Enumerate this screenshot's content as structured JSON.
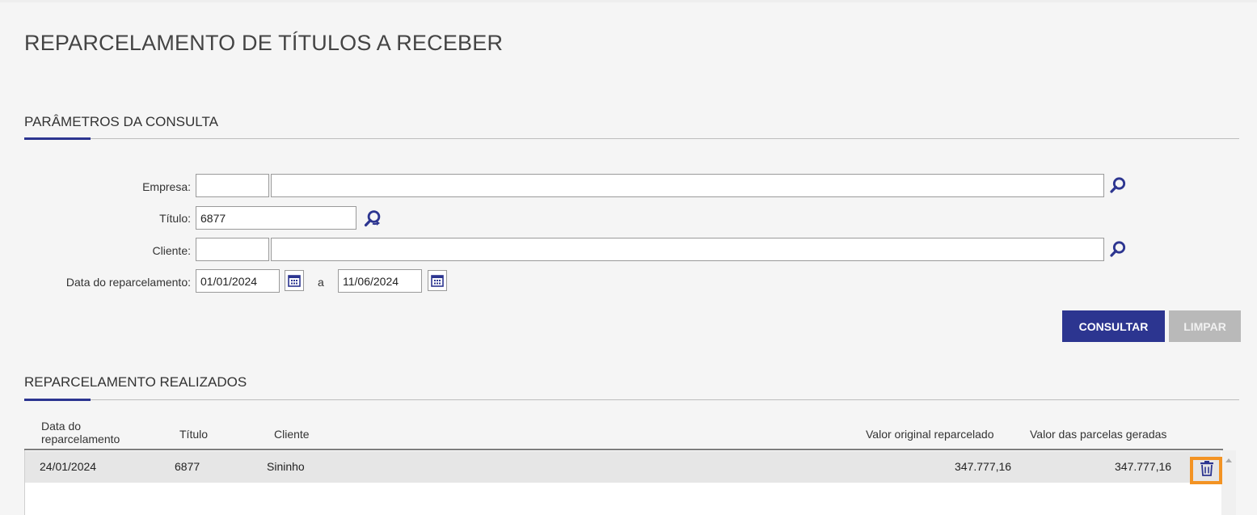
{
  "page": {
    "title": "REPARCELAMENTO DE TÍTULOS A RECEBER"
  },
  "query_section": {
    "title": "PARÂMETROS DA CONSULTA",
    "fields": {
      "empresa_label": "Empresa:",
      "empresa_code": "",
      "empresa_name": "",
      "titulo_label": "Título:",
      "titulo_value": "6877",
      "cliente_label": "Cliente:",
      "cliente_code": "",
      "cliente_name": "",
      "data_label": "Data do reparcelamento:",
      "data_from": "01/01/2024",
      "data_sep": "a",
      "data_to": "11/06/2024"
    },
    "buttons": {
      "consultar": "CONSULTAR",
      "limpar": "LIMPAR"
    }
  },
  "results_section": {
    "title": "REPARCELAMENTO REALIZADOS",
    "columns": {
      "data_line1": "Data do",
      "data_line2": "reparcelamento",
      "titulo": "Título",
      "cliente": "Cliente",
      "valor_original": "Valor original reparcelado",
      "valor_parcelas": "Valor das parcelas geradas"
    },
    "rows": [
      {
        "data": "24/01/2024",
        "titulo": "6877",
        "cliente": "Sininho",
        "valor_original": "347.777,16",
        "valor_parcelas": "347.777,16"
      }
    ]
  },
  "colors": {
    "accent": "#2c3590",
    "disabled": "#b9b9b9",
    "highlight": "#f39323"
  },
  "icons": {
    "search": "search-icon",
    "search_refresh": "search-refresh-icon",
    "calendar": "calendar-icon",
    "trash": "trash-icon"
  }
}
